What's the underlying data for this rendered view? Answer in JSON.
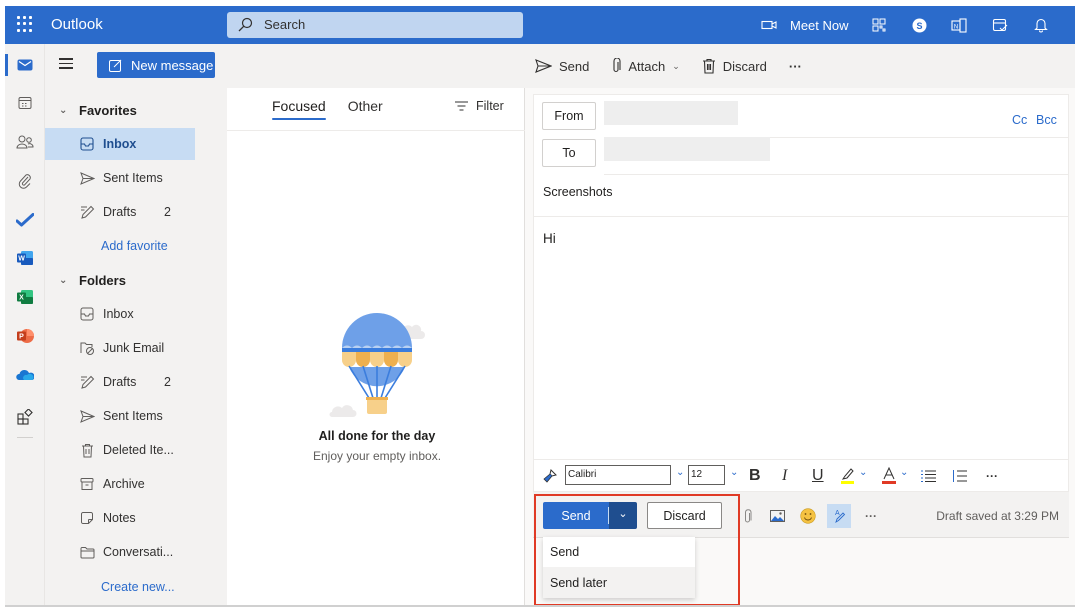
{
  "topbar": {
    "app_title": "Outlook",
    "search_placeholder": "Search",
    "meet_now_label": "Meet Now",
    "icons": [
      "waffle-icon",
      "video-camera-icon",
      "qr-code-icon",
      "skype-icon",
      "onenote-feed-icon",
      "my-day-icon",
      "notification-bell-icon"
    ]
  },
  "rail": {
    "items": [
      "mail",
      "calendar",
      "people",
      "files",
      "to-do",
      "word",
      "excel",
      "powerpoint",
      "onedrive",
      "apps"
    ]
  },
  "command_bar": {
    "new_message_label": "New message",
    "send_label": "Send",
    "attach_label": "Attach",
    "discard_label": "Discard",
    "more_label": "···"
  },
  "folders": {
    "favorites_label": "Favorites",
    "favorites": [
      {
        "label": "Inbox",
        "icon": "inbox",
        "count": "",
        "selected": true
      },
      {
        "label": "Sent Items",
        "icon": "send",
        "count": ""
      },
      {
        "label": "Drafts",
        "icon": "drafts",
        "count": "2"
      }
    ],
    "add_favorite_label": "Add favorite",
    "folders_label": "Folders",
    "items": [
      {
        "label": "Inbox",
        "icon": "inbox",
        "count": ""
      },
      {
        "label": "Junk Email",
        "icon": "junk",
        "count": ""
      },
      {
        "label": "Drafts",
        "icon": "drafts",
        "count": "2"
      },
      {
        "label": "Sent Items",
        "icon": "send",
        "count": ""
      },
      {
        "label": "Deleted Ite...",
        "icon": "trash",
        "count": ""
      },
      {
        "label": "Archive",
        "icon": "archive",
        "count": ""
      },
      {
        "label": "Notes",
        "icon": "notes",
        "count": ""
      },
      {
        "label": "Conversati...",
        "icon": "folder",
        "count": ""
      }
    ],
    "create_new_label": "Create new..."
  },
  "message_list": {
    "tabs": [
      {
        "label": "Focused",
        "active": true
      },
      {
        "label": "Other",
        "active": false
      }
    ],
    "filter_label": "Filter",
    "empty_title": "All done for the day",
    "empty_subtitle": "Enjoy your empty inbox."
  },
  "compose": {
    "from_label": "From",
    "to_label": "To",
    "from_value": "",
    "to_value": "",
    "cc_label": "Cc",
    "bcc_label": "Bcc",
    "subject": "Screenshots",
    "body": "Hi"
  },
  "format_bar": {
    "font_name": "Calibri",
    "font_size": "12",
    "bold": "B",
    "italic": "I",
    "underline": "U",
    "highlight_color": "#ffff00",
    "font_color": "#e03a25",
    "more_label": "···"
  },
  "send_bar": {
    "send_label": "Send",
    "discard_label": "Discard",
    "more_label": "···",
    "draft_status": "Draft saved at 3:29 PM"
  },
  "send_dropdown": {
    "items": [
      {
        "label": "Send",
        "hover": false
      },
      {
        "label": "Send later",
        "hover": true
      }
    ]
  },
  "annotation": {
    "highlight_color": "#e03a25"
  }
}
